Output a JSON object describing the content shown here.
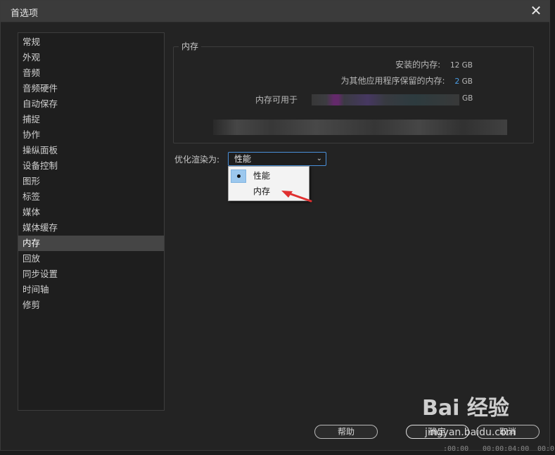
{
  "window": {
    "title": "首选项",
    "close_glyph": "✕"
  },
  "sidebar": {
    "items": [
      {
        "label": "常规"
      },
      {
        "label": "外观"
      },
      {
        "label": "音频"
      },
      {
        "label": "音频硬件"
      },
      {
        "label": "自动保存"
      },
      {
        "label": "捕捉"
      },
      {
        "label": "协作"
      },
      {
        "label": "操纵面板"
      },
      {
        "label": "设备控制"
      },
      {
        "label": "图形"
      },
      {
        "label": "标签"
      },
      {
        "label": "媒体"
      },
      {
        "label": "媒体缓存"
      },
      {
        "label": "内存",
        "selected": true
      },
      {
        "label": "回放"
      },
      {
        "label": "同步设置"
      },
      {
        "label": "时间轴"
      },
      {
        "label": "修剪"
      }
    ]
  },
  "memory": {
    "group_title": "内存",
    "installed_label": "安装的内存:",
    "installed_value": "12 GB",
    "reserved_label": "为其他应用程序保留的内存:",
    "reserved_number": "2",
    "reserved_unit": "GB",
    "available_label": "内存可用于",
    "available_unit": "GB"
  },
  "optimize": {
    "label": "优化渲染为:",
    "selected": "性能",
    "options": [
      "性能",
      "内存"
    ]
  },
  "buttons": {
    "help": "帮助",
    "ok": "确定",
    "cancel": "取消"
  },
  "watermark": {
    "brand": "Bai 经验",
    "url": "jingyan.baidu.com"
  },
  "background": {
    "timecode_1": ":00:00",
    "timecode_2": "00:00:04:00",
    "timecode_3": "00:0"
  },
  "colors": {
    "accent": "#4a9ee6",
    "focus_border": "#4a90d9",
    "annotation_arrow": "#e03030"
  }
}
